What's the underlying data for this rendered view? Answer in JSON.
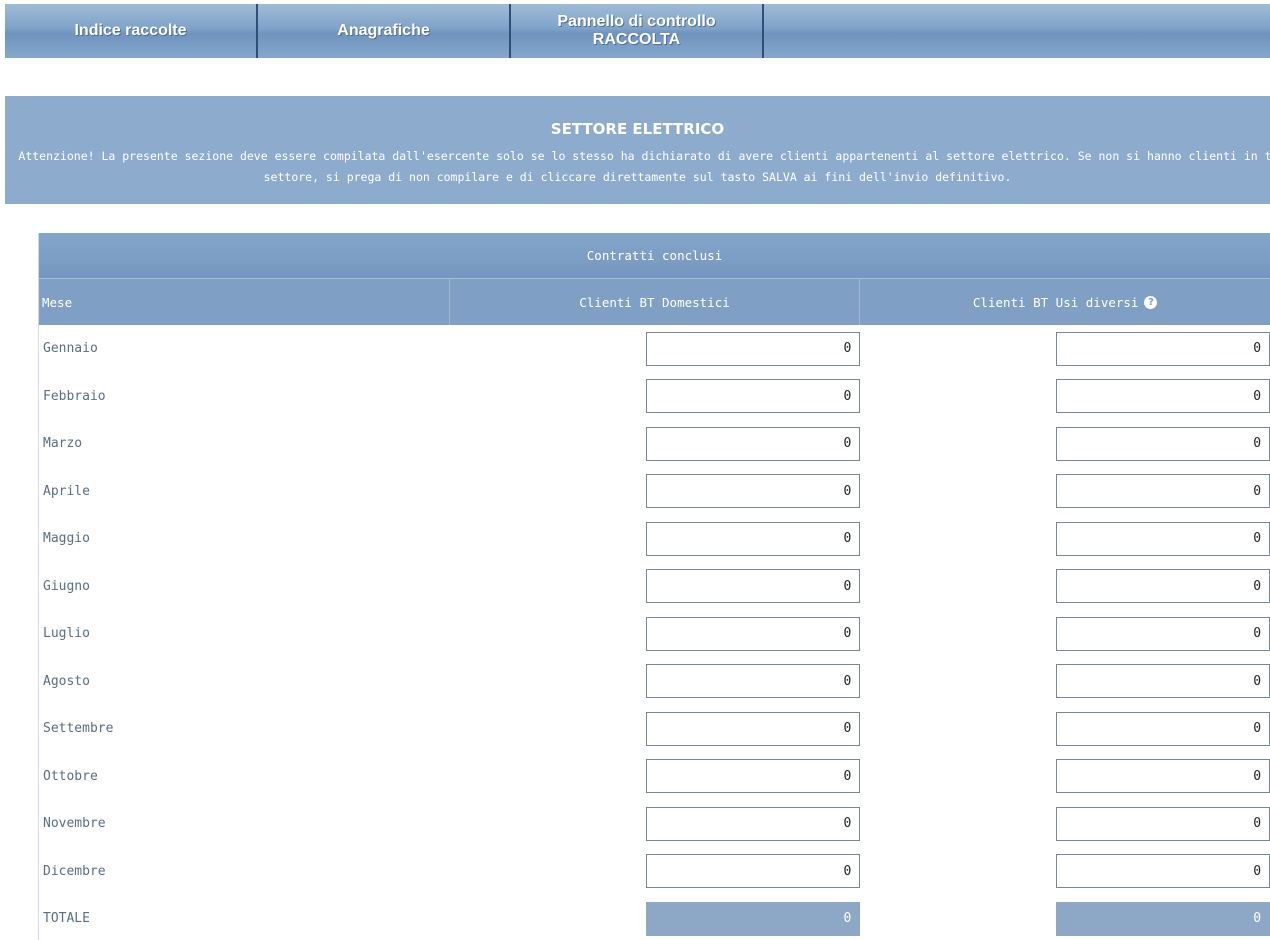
{
  "nav": {
    "items": [
      {
        "label": "Indice raccolte"
      },
      {
        "label": "Anagrafiche"
      },
      {
        "label_line1": "Pannello di controllo",
        "label_line2": "RACCOLTA"
      }
    ]
  },
  "banner": {
    "title": "SETTORE ELETTRICO",
    "text_line1": "Attenzione! La presente sezione deve essere compilata dall'esercente solo se lo stesso ha dichiarato di avere clienti appartenenti al settore elettrico. Se non si hanno clienti in t",
    "text_line2": "settore, si prega di non compilare e di cliccare direttamente sul tasto SALVA ai fini dell'invio definitivo."
  },
  "table": {
    "group_header": "Contratti conclusi",
    "col_mese": "Mese",
    "col_domestici": "Clienti BT Domestici",
    "col_usi_diversi": "Clienti BT Usi diversi",
    "rows": [
      {
        "mese": "Gennaio",
        "domestici": "0",
        "usi_diversi": "0"
      },
      {
        "mese": "Febbraio",
        "domestici": "0",
        "usi_diversi": "0"
      },
      {
        "mese": "Marzo",
        "domestici": "0",
        "usi_diversi": "0"
      },
      {
        "mese": "Aprile",
        "domestici": "0",
        "usi_diversi": "0"
      },
      {
        "mese": "Maggio",
        "domestici": "0",
        "usi_diversi": "0"
      },
      {
        "mese": "Giugno",
        "domestici": "0",
        "usi_diversi": "0"
      },
      {
        "mese": "Luglio",
        "domestici": "0",
        "usi_diversi": "0"
      },
      {
        "mese": "Agosto",
        "domestici": "0",
        "usi_diversi": "0"
      },
      {
        "mese": "Settembre",
        "domestici": "0",
        "usi_diversi": "0"
      },
      {
        "mese": "Ottobre",
        "domestici": "0",
        "usi_diversi": "0"
      },
      {
        "mese": "Novembre",
        "domestici": "0",
        "usi_diversi": "0"
      },
      {
        "mese": "Dicembre",
        "domestici": "0",
        "usi_diversi": "0"
      }
    ],
    "total": {
      "mese": "TOTALE",
      "domestici": "0",
      "usi_diversi": "0"
    }
  },
  "icons": {
    "help": "help-icon"
  },
  "colors": {
    "nav": "#7fa2c8",
    "banner": "#8cabcd",
    "header": "#7f9fc5",
    "total_field": "#8da8c6"
  }
}
